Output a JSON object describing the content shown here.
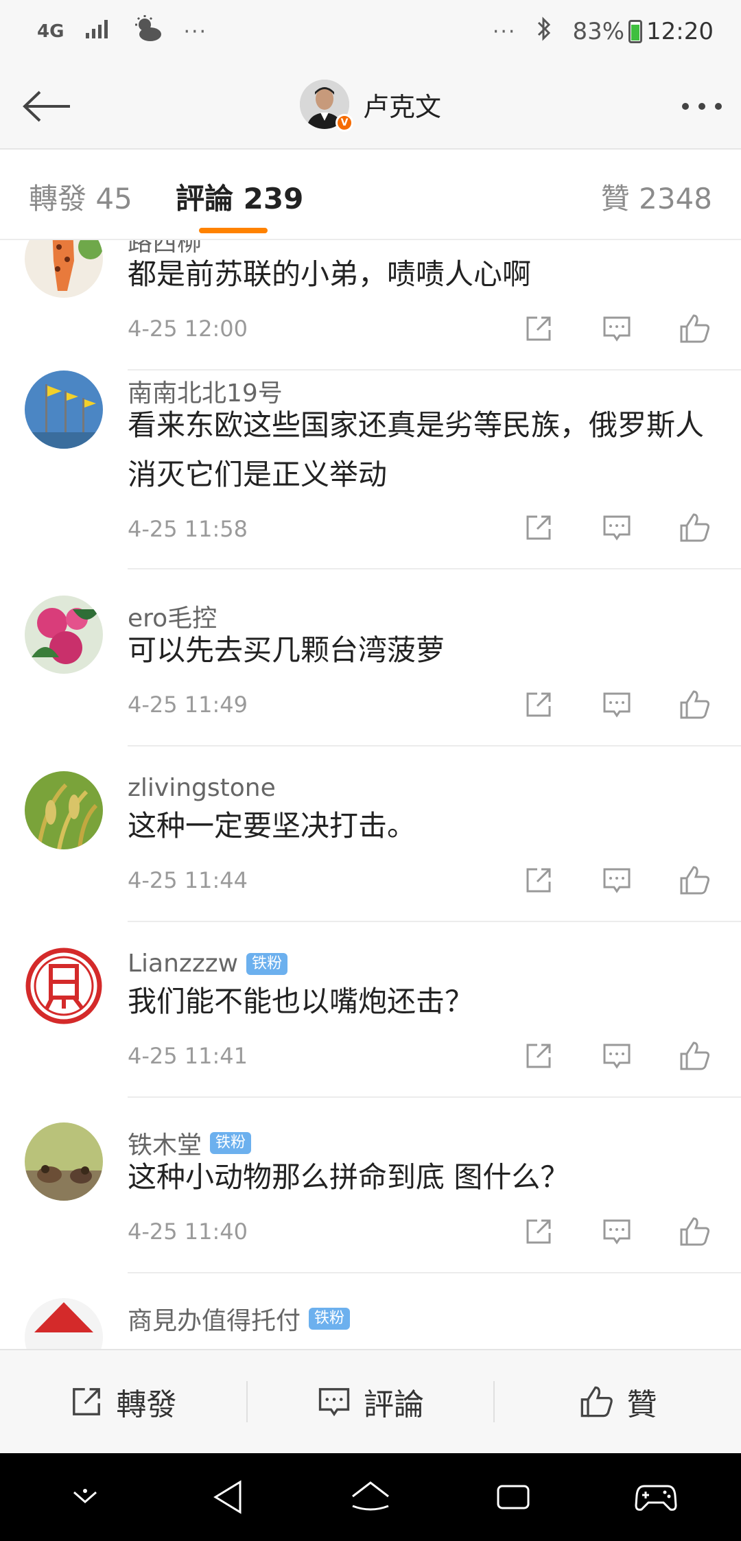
{
  "status_bar": {
    "network": "4G",
    "more_left": "···",
    "more_right": "···",
    "battery": "83%",
    "time": "12:20"
  },
  "header": {
    "title": "卢克文",
    "verified_mark": "V"
  },
  "tabs": {
    "reposts": "轉發 45",
    "comments": "評論 239",
    "likes": "贊 2348"
  },
  "comments": [
    {
      "name": "路西柳",
      "badge": "",
      "text": "都是前苏联的小弟，啧啧人心啊",
      "time": "4-25 12:00"
    },
    {
      "name": "南南北北19号",
      "badge": "",
      "text": "看来东欧这些国家还真是劣等民族，俄罗斯人消灭它们是正义举动",
      "time": "4-25 11:58"
    },
    {
      "name": "ero毛控",
      "badge": "",
      "text": "可以先去买几颗台湾菠萝",
      "time": "4-25 11:49"
    },
    {
      "name": "zlivingstone",
      "badge": "",
      "text": "这种一定要坚决打击。",
      "time": "4-25 11:44"
    },
    {
      "name": "Lianzzzw",
      "badge": "铁粉",
      "text": "我们能不能也以嘴炮还击？",
      "time": "4-25 11:41"
    },
    {
      "name": "铁木堂",
      "badge": "铁粉",
      "text": "这种小动物那么拼命到底  图什么？",
      "time": "4-25 11:40"
    },
    {
      "name": "商見办值得托付",
      "badge": "铁粉",
      "text": "",
      "time": ""
    }
  ],
  "toolbar": {
    "repost": "轉發",
    "comment": "評論",
    "like": "贊"
  },
  "colors": {
    "accent": "#ff8200",
    "badge_blue": "#6cb0ee",
    "verified": "#f56b00"
  }
}
